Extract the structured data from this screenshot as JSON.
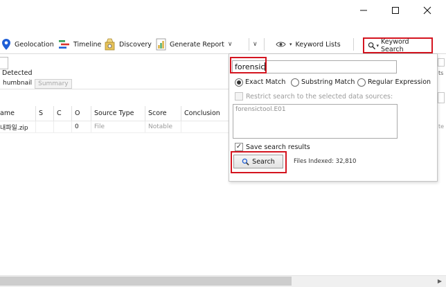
{
  "window": {
    "minimize_icon": "minimize-icon",
    "maximize_icon": "maximize-icon",
    "close_icon": "close-icon"
  },
  "toolbar": {
    "geolocation": "Geolocation",
    "timeline": "Timeline",
    "discovery": "Discovery",
    "generate_report": "Generate Report",
    "keyword_lists": "Keyword Lists",
    "keyword_search": "Keyword Search"
  },
  "results": {
    "detected_label": "Detected",
    "tabs": [
      "humbnail",
      "Summary"
    ],
    "columns": [
      "ame",
      "S",
      "C",
      "O",
      "Source Type",
      "Score",
      "Conclusion"
    ],
    "rows": [
      {
        "name": "내파일.zip",
        "s": "",
        "c": "",
        "o": "0",
        "source_type": "File",
        "score": "Notable",
        "conclusion": ""
      }
    ]
  },
  "keyword_popup": {
    "search_value": "forensic",
    "match_options": [
      "Exact Match",
      "Substring Match",
      "Regular Expression"
    ],
    "selected_match": "Exact Match",
    "restrict_label": "Restrict search to the selected data sources:",
    "data_sources": "forensictool.E01",
    "save_label": "Save search results",
    "save_checked": true,
    "search_button": "Search",
    "files_indexed": "Files Indexed: 32,810"
  },
  "edge_text": {
    "right_partial_1": "ts",
    "right_partial_2": "te"
  },
  "colors": {
    "highlight": "#d4141f",
    "geolocation_pin": "#1f5fd6",
    "timeline_icon": "#2e9b4e",
    "report_icon": "#d4a017"
  }
}
